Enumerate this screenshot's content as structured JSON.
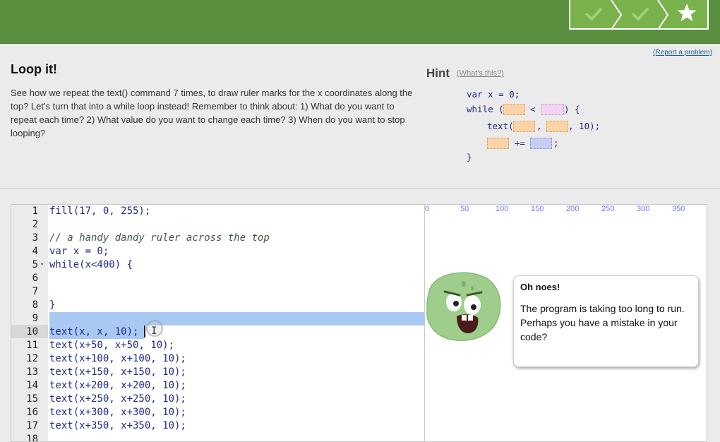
{
  "header": {
    "report_link": "(Report a problem)",
    "title": "Loop it!",
    "description": "See how we repeat the text() command 7 times, to draw ruler marks for the x coordinates along the top? Let's turn that into a while loop instead! Remember to think about: 1) What do you want to repeat each time? 2) What value do you want to change each time? 3) When do you want to stop looping?"
  },
  "progress": {
    "steps": [
      "check-icon",
      "check-icon",
      "star-icon"
    ],
    "colors": {
      "bar": "#5a8f3f",
      "steps": "#79b14b"
    }
  },
  "hint": {
    "title": "Hint",
    "whats_this": "(What's this?)",
    "line1": "var x = 0;",
    "line2_start": "while (",
    "line2_op": "<",
    "line2_end": ") {",
    "line3_start": "text(",
    "line3_sep": ",",
    "line3_end": ", 10);",
    "line4_op": "+=",
    "line4_end": ";",
    "line5": "}"
  },
  "editor": {
    "lines": [
      {
        "n": "1",
        "code": "fill(17, 0, 255);"
      },
      {
        "n": "2",
        "code": ""
      },
      {
        "n": "3",
        "code": "// a handy dandy ruler across the top"
      },
      {
        "n": "4",
        "code": "var x = 0;"
      },
      {
        "n": "5",
        "code": "while(x<400) {"
      },
      {
        "n": "6",
        "code": ""
      },
      {
        "n": "7",
        "code": ""
      },
      {
        "n": "8",
        "code": "}"
      },
      {
        "n": "9",
        "code": ""
      },
      {
        "n": "10",
        "code": "text(x, x, 10);"
      },
      {
        "n": "11",
        "code": "text(x+50, x+50, 10);"
      },
      {
        "n": "12",
        "code": "text(x+100, x+100, 10);"
      },
      {
        "n": "13",
        "code": "text(x+150, x+150, 10);"
      },
      {
        "n": "14",
        "code": "text(x+200, x+200, 10);"
      },
      {
        "n": "15",
        "code": "text(x+250, x+250, 10);"
      },
      {
        "n": "16",
        "code": "text(x+300, x+300, 10);"
      },
      {
        "n": "17",
        "code": "text(x+350, x+350, 10);"
      },
      {
        "n": "18",
        "code": ""
      }
    ],
    "fold_marker": "▾",
    "selection_color": "#a9c9f3"
  },
  "canvas": {
    "ruler": [
      "0",
      "50",
      "100",
      "150",
      "200",
      "250",
      "300",
      "350"
    ],
    "text_color": "#6f74ff"
  },
  "error": {
    "title": "Oh noes!",
    "message": "The program is taking too long to run. Perhaps you have a mistake in your code?"
  }
}
